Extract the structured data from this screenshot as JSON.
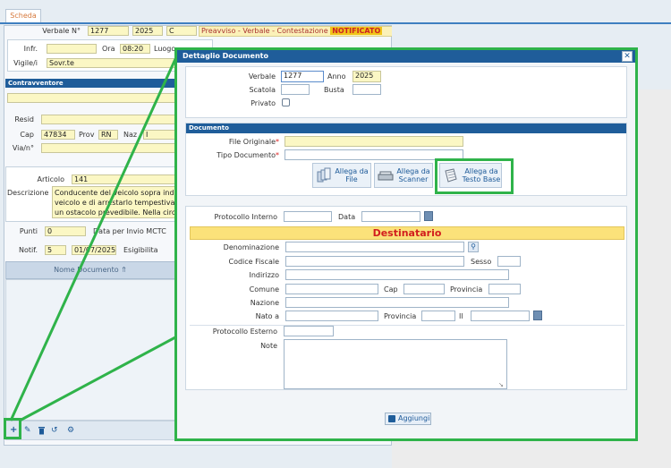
{
  "tab": {
    "label": "Scheda"
  },
  "header": {
    "verbale_label": "Verbale N°",
    "verbale_num": "1277",
    "verbale_year": "2025",
    "verbale_suffix": "C",
    "title_text": "Preavviso - Verbale - Contestazione",
    "status": "NOTIFICATO"
  },
  "bg": {
    "infr_label": "Infr.",
    "ora_label": "Ora",
    "ora_value": "08:20",
    "luogo_label": "Luogo",
    "vigile_label": "Vigile/i",
    "vigile_value": "Sovr.te",
    "contravv_head": "Contravventore",
    "resid_label": "Resid",
    "cap_label": "Cap",
    "cap_value": "47834",
    "prov_label": "Prov",
    "prov_value": "RN",
    "naz_label": "Naz",
    "naz_value": "I",
    "via_label": "Via/n°",
    "articolo_label": "Articolo",
    "articolo_value": "141",
    "descr_label": "Descrizione",
    "descr_line1": "Conducente del veicolo sopra indic",
    "descr_line2": "veicolo e di arrestarlo tempestivam",
    "descr_line3": "un ostacolo prevedibile. Nella circo",
    "punti_label": "Punti",
    "punti_value": "0",
    "data_mctc_label": "Data per Invio MCTC",
    "notif_label": "Notif.",
    "notif_value": "5",
    "notif_date": "01/07/2025",
    "esigibilita_label": "Esigibilita",
    "nome_doc_label": "Nome Documento"
  },
  "dialog": {
    "title": "Dettaglio Documento",
    "verbale_label": "Verbale",
    "verbale_value": "1277",
    "anno_label": "Anno",
    "anno_value": "2025",
    "scatola_label": "Scatola",
    "busta_label": "Busta",
    "privato_label": "Privato",
    "documento_head": "Documento",
    "file_originale_label": "File Originale",
    "tipo_documento_label": "Tipo Documento",
    "btn_allega_file": [
      "Allega da",
      "File"
    ],
    "btn_allega_scanner": [
      "Allega da",
      "Scanner"
    ],
    "btn_allega_testo": [
      "Allega da",
      "Testo Base"
    ],
    "protocollo_interno_label": "Protocollo Interno",
    "data_label": "Data",
    "destinatario_head": "Destinatario",
    "denominazione_label": "Denominazione",
    "codice_fiscale_label": "Codice Fiscale",
    "sesso_label": "Sesso",
    "indirizzo_label": "Indirizzo",
    "comune_label": "Comune",
    "cap_label": "Cap",
    "provincia_label": "Provincia",
    "nazione_label": "Nazione",
    "nato_a_label": "Nato a",
    "provincia2_label": "Provincia",
    "il_label": "Il",
    "protocollo_esterno_label": "Protocollo Esterno",
    "note_label": "Note",
    "aggiungi_label": "Aggiungi"
  },
  "colors": {
    "accent": "#1f5d9a",
    "highlight": "#2fb34a",
    "status": "#f0c419"
  }
}
